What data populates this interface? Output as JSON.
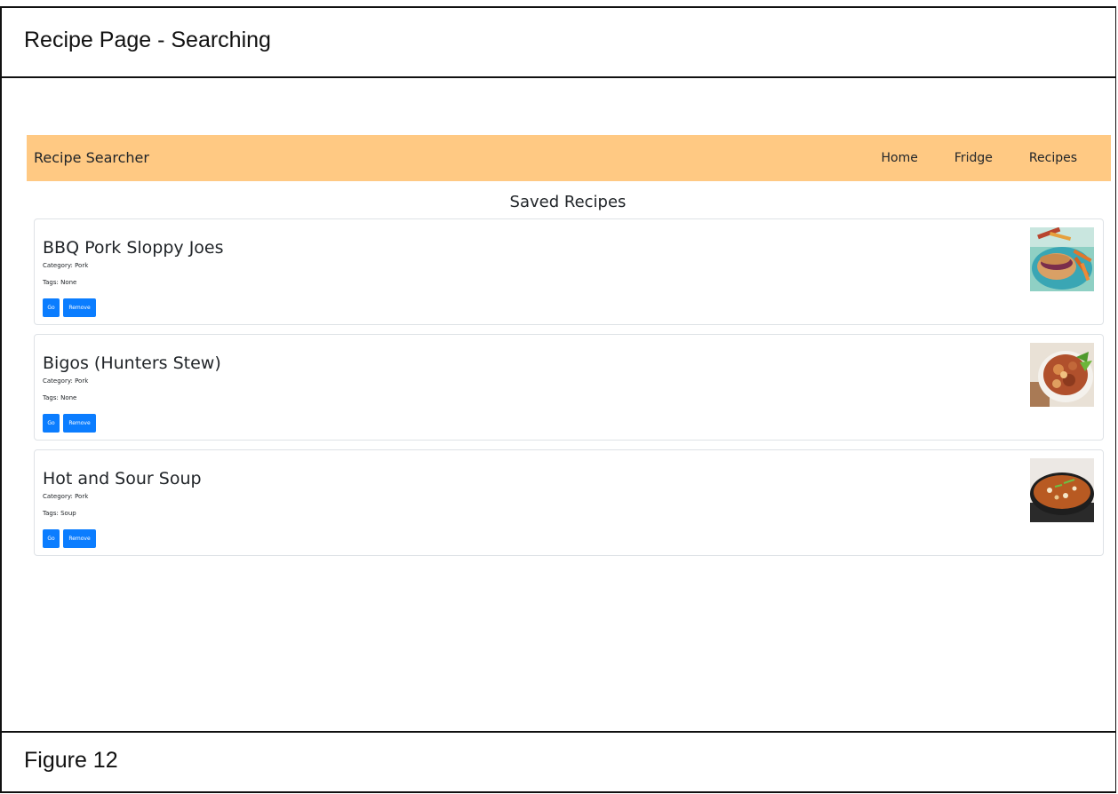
{
  "frame": {
    "title": "Recipe Page - Searching",
    "caption": "Figure 12"
  },
  "navbar": {
    "brand": "Recipe Searcher",
    "links": [
      "Home",
      "Fridge",
      "Recipes"
    ],
    "background": "#ffc983"
  },
  "page": {
    "heading": "Saved Recipes"
  },
  "recipes": [
    {
      "title": "BBQ Pork Sloppy Joes",
      "category_label": "Category: ",
      "category": "Pork",
      "tags_label": "Tags: ",
      "tags": "None",
      "image": "sloppy-joe-photo"
    },
    {
      "title": "Bigos (Hunters Stew)",
      "category_label": "Category: ",
      "category": "Pork",
      "tags_label": "Tags: ",
      "tags": "None",
      "image": "stew-bowl-photo"
    },
    {
      "title": "Hot and Sour Soup",
      "category_label": "Category: ",
      "category": "Pork",
      "tags_label": "Tags: ",
      "tags": "Soup",
      "image": "soup-pot-photo"
    }
  ],
  "buttons": {
    "go_label": "Go",
    "remove_label": "Remove",
    "color": "#0b7dff"
  }
}
